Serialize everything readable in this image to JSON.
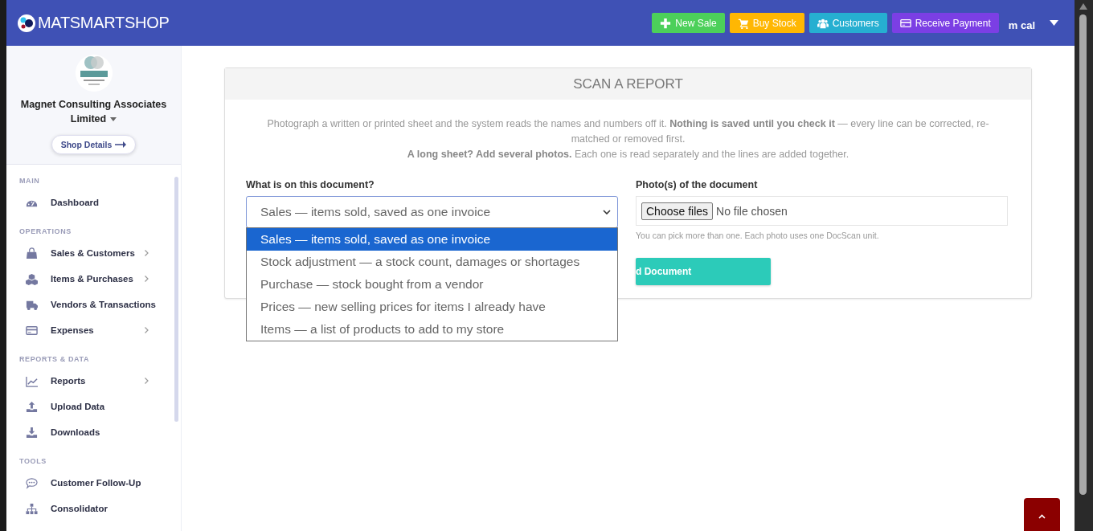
{
  "brand": {
    "name": "MATSMARTSHOP"
  },
  "header_buttons": [
    {
      "label": "New Sale",
      "kind": "plus",
      "color": "#4cd05a"
    },
    {
      "label": "Buy Stock",
      "kind": "cart",
      "color": "#ffb703"
    },
    {
      "label": "Customers",
      "kind": "users",
      "color": "#26afd1"
    },
    {
      "label": "Receive Payment",
      "kind": "card",
      "color": "#7b3fe4"
    }
  ],
  "user": {
    "name": "m cal"
  },
  "shop": {
    "name": "Magnet Consulting Associates Limited",
    "details_link": "Shop Details"
  },
  "sidebar": {
    "sections": [
      {
        "title": "MAIN",
        "items": [
          {
            "label": "Dashboard",
            "kind": "gauge",
            "has_submenu": false
          }
        ]
      },
      {
        "title": "OPERATIONS",
        "items": [
          {
            "label": "Sales & Customers",
            "kind": "bag",
            "has_submenu": true
          },
          {
            "label": "Items & Purchases",
            "kind": "boxes",
            "has_submenu": true
          },
          {
            "label": "Vendors & Transactions",
            "kind": "truck",
            "has_submenu": false
          },
          {
            "label": "Expenses",
            "kind": "card",
            "has_submenu": true
          }
        ]
      },
      {
        "title": "REPORTS & DATA",
        "items": [
          {
            "label": "Reports",
            "kind": "chart",
            "has_submenu": true
          },
          {
            "label": "Upload Data",
            "kind": "upload",
            "has_submenu": false
          },
          {
            "label": "Downloads",
            "kind": "download",
            "has_submenu": false
          }
        ]
      },
      {
        "title": "TOOLS",
        "items": [
          {
            "label": "Customer Follow-Up",
            "kind": "chat",
            "has_submenu": false
          },
          {
            "label": "Consolidator",
            "kind": "sitemap",
            "has_submenu": false
          }
        ]
      }
    ]
  },
  "card": {
    "title": "SCAN A REPORT",
    "intro": [
      "Photograph a written or printed sheet and the system reads the names and numbers off it. **Nothing is saved until you check it** — every line can be corrected, re-matched or removed first.",
      "**A long sheet? Add several photos.** Each one is read separately and the lines are added together."
    ],
    "document_type": {
      "label": "What is on this document?",
      "value": "Sales — items sold, saved as one invoice",
      "expanded": true,
      "options": [
        {
          "label": "Sales — items sold, saved as one invoice",
          "selected": true
        },
        {
          "label": "Stock adjustment — a stock count, damages or shortages",
          "selected": false
        },
        {
          "label": "Purchase — stock bought from a vendor",
          "selected": false
        },
        {
          "label": "Prices — new selling prices for items I already have",
          "selected": false
        },
        {
          "label": "Items — a list of products to add to my store",
          "selected": false
        }
      ]
    },
    "photos": {
      "label": "Photo(s) of the document",
      "button": "Choose files",
      "status": "No file chosen",
      "hint": "You can pick more than one. Each photo uses one DocScan unit."
    },
    "submit": "d Document"
  }
}
